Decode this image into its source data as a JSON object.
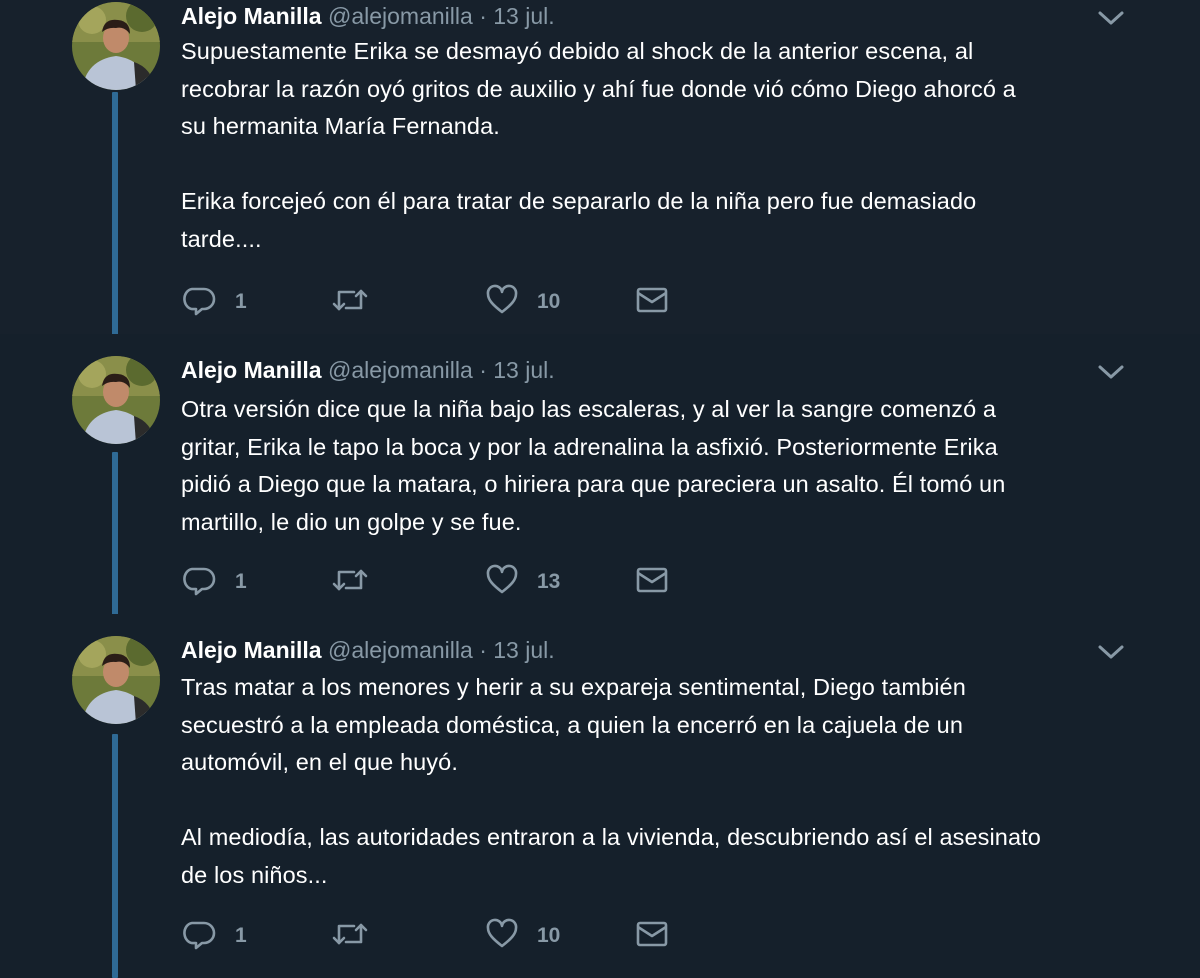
{
  "tweets": [
    {
      "author_name": "Alejo Manilla",
      "handle": "@alejomanilla",
      "separator": "·",
      "date": "13 jul.",
      "text": "Supuestamente Erika se desmayó debido al shock de la anterior escena, al\nrecobrar la razón oyó gritos de auxilio y ahí fue donde vió cómo Diego ahorcó a\nsu hermanita María Fernanda.\n\nErika forcejeó con él para tratar de separarlo de la niña pero fue demasiado\ntarde....",
      "reply_count": "1",
      "retweet_count": "",
      "like_count": "10"
    },
    {
      "author_name": "Alejo Manilla",
      "handle": "@alejomanilla",
      "separator": "·",
      "date": "13 jul.",
      "text": "Otra versión dice que la niña bajo las escaleras, y al ver la sangre comenzó a\ngritar, Erika le tapo la boca y por la adrenalina la asfixió. Posteriormente Erika\npidió a Diego que la matara, o hiriera para que pareciera un asalto. Él tomó un\nmartillo, le dio un golpe y se fue.",
      "reply_count": "1",
      "retweet_count": "",
      "like_count": "13"
    },
    {
      "author_name": "Alejo Manilla",
      "handle": "@alejomanilla",
      "separator": "·",
      "date": "13 jul.",
      "text": "Tras matar a los menores y herir a su expareja sentimental, Diego también\nsecuestró a la empleada doméstica, a quien la encerró en la cajuela de un\nautomóvil, en el que huyó.\n\nAl mediodía, las autoridades entraron a la vivienda, descubriendo así el asesinato\nde los niños...",
      "reply_count": "1",
      "retweet_count": "",
      "like_count": "10"
    }
  ],
  "icons": {
    "reply": "reply-icon",
    "retweet": "retweet-icon",
    "like": "heart-icon",
    "message": "envelope-icon",
    "menu": "chevron-down-icon"
  },
  "colors": {
    "background": "#15202b",
    "background_first": "#17212c",
    "secondary_text": "#8899a6",
    "thread_line": "#2f6a95"
  }
}
